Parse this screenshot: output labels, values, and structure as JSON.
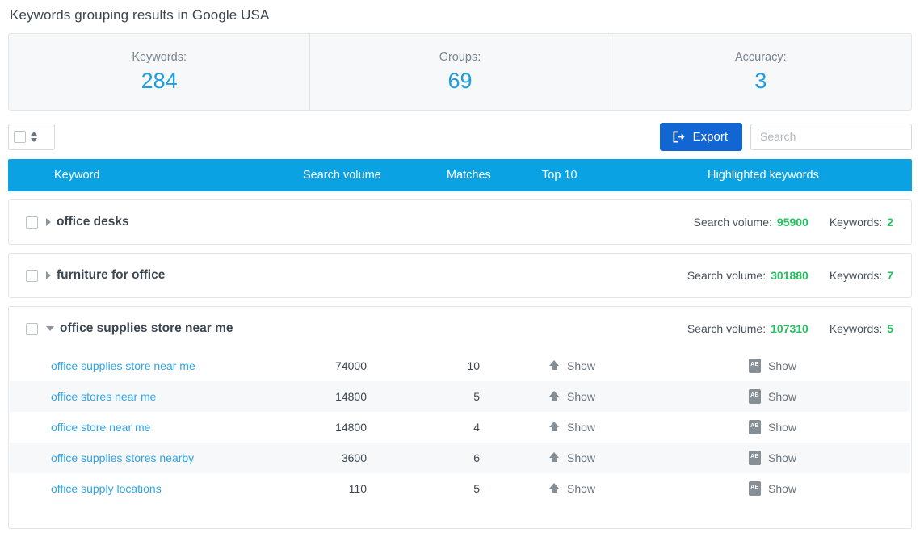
{
  "page": {
    "title": "Keywords grouping results in Google USA"
  },
  "summary": [
    {
      "label": "Keywords:",
      "value": "284"
    },
    {
      "label": "Groups:",
      "value": "69"
    },
    {
      "label": "Accuracy:",
      "value": "3"
    }
  ],
  "toolbar": {
    "select_all_icon": "checkbox-unchecked",
    "spinner_icon": "sort-arrows",
    "export_label": "Export",
    "export_icon": "export-icon",
    "search_placeholder": "Search",
    "search_value": ""
  },
  "table": {
    "columns": [
      "Keyword",
      "Search volume",
      "Matches",
      "Top 10",
      "Highlighted keywords"
    ],
    "group_stat_labels": {
      "volume": "Search volume:",
      "keywords": "Keywords:"
    },
    "show_label": "Show",
    "top10_icon": "upload-arrow-icon",
    "highlighted_icon": "ab-text-icon"
  },
  "groups": [
    {
      "name": "office desks",
      "expanded": false,
      "caret": "caret-right-icon",
      "search_volume": "95900",
      "keywords": "2",
      "rows": []
    },
    {
      "name": "furniture for office",
      "expanded": false,
      "caret": "caret-right-icon",
      "search_volume": "301880",
      "keywords": "7",
      "rows": []
    },
    {
      "name": "office supplies store near me",
      "expanded": true,
      "caret": "caret-down-icon",
      "search_volume": "107310",
      "keywords": "5",
      "rows": [
        {
          "keyword": "office supplies store near me",
          "volume": "74000",
          "matches": "10",
          "top10": "Show",
          "highlighted": "Show"
        },
        {
          "keyword": "office stores near me",
          "volume": "14800",
          "matches": "5",
          "top10": "Show",
          "highlighted": "Show"
        },
        {
          "keyword": "office store near me",
          "volume": "14800",
          "matches": "4",
          "top10": "Show",
          "highlighted": "Show"
        },
        {
          "keyword": "office supplies stores nearby",
          "volume": "3600",
          "matches": "6",
          "top10": "Show",
          "highlighted": "Show"
        },
        {
          "keyword": "office supply locations",
          "volume": "110",
          "matches": "5",
          "top10": "Show",
          "highlighted": "Show"
        }
      ]
    }
  ],
  "colors": {
    "accent_blue": "#0aa2e3",
    "export_blue": "#1266d4",
    "stat_value_blue": "#1a9fe0",
    "green": "#25c15e",
    "link_blue": "#31a5e8"
  }
}
